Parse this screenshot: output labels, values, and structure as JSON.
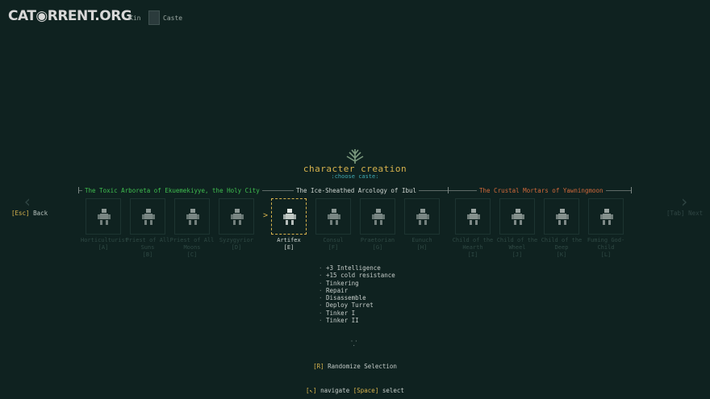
{
  "logo": "CAT◉RRENT.ORG",
  "breadcrumb": {
    "kin": "Kin",
    "caste": "Caste"
  },
  "header": {
    "title": "character creation",
    "subtitle": ":choose caste:"
  },
  "factions": [
    {
      "name": "The Toxic Arboreta of Ekuemekiyye, the Holy City",
      "color": "#3fbf4f"
    },
    {
      "name": "The Ice-Sheathed Arcology of Ibul",
      "color": "#cfd6d2"
    },
    {
      "name": "The Crustal Mortars of Yawningmoon",
      "color": "#d2693a"
    }
  ],
  "nav": {
    "back_key": "[Esc]",
    "back_label": "Back",
    "next_label": "[Tab] Next"
  },
  "castes": [
    {
      "name": "Horticulturist",
      "key": "[A]",
      "selected": false
    },
    {
      "name": "Priest of All Suns",
      "key": "[B]",
      "selected": false
    },
    {
      "name": "Priest of All Moons",
      "key": "[C]",
      "selected": false
    },
    {
      "name": "Syzygyrior",
      "key": "[D]",
      "selected": false
    },
    {
      "name": "Artifex",
      "key": "[E]",
      "selected": true
    },
    {
      "name": "Consul",
      "key": "[F]",
      "selected": false
    },
    {
      "name": "Praetorian",
      "key": "[G]",
      "selected": false
    },
    {
      "name": "Eunuch",
      "key": "[H]",
      "selected": false
    },
    {
      "name": "Child of the Hearth",
      "key": "[I]",
      "selected": false
    },
    {
      "name": "Child of the Wheel",
      "key": "[J]",
      "selected": false
    },
    {
      "name": "Child of the Deep",
      "key": "[K]",
      "selected": false
    },
    {
      "name": "Fuming God-Child",
      "key": "[L]",
      "selected": false
    }
  ],
  "bonuses": [
    "+3 Intelligence",
    "+15 cold resistance",
    "Tinkering",
    "Repair",
    "Disassemble",
    "Deploy Turret",
    "Tinker I",
    "Tinker II"
  ],
  "randomize": {
    "key": "[R]",
    "label": "Randomize Selection"
  },
  "footer": {
    "navigate_key": "[↖]",
    "navigate_label": "navigate",
    "select_key": "[Space]",
    "select_label": "select"
  },
  "colors": {
    "background": "#0f2220",
    "accent": "#d7b34d",
    "green": "#3fbf4f",
    "orange": "#d2693a"
  }
}
